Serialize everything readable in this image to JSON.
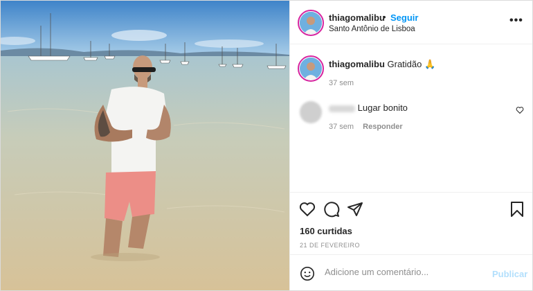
{
  "post": {
    "username": "thiagomalibu",
    "separator": "•",
    "follow_label": "Seguir",
    "location": "Santo Antônio de Lisboa",
    "more_label": "•••"
  },
  "caption": {
    "username": "thiagomalibu",
    "text": "Gratidão",
    "emoji": "🙏",
    "time": "37 sem"
  },
  "comment": {
    "text": "Lugar bonito",
    "time": "37 sem",
    "reply_label": "Responder"
  },
  "actions": {
    "icons": [
      "heart-icon",
      "comment-icon",
      "share-icon",
      "bookmark-icon"
    ],
    "likes": "160 curtidas",
    "date": "21 DE FEVEREIRO"
  },
  "composer": {
    "placeholder": "Adicione um comentário...",
    "publish_label": "Publicar"
  },
  "colors": {
    "link": "#0095f6",
    "muted": "#8e8e8e",
    "publish_disabled": "#b2dffc"
  }
}
